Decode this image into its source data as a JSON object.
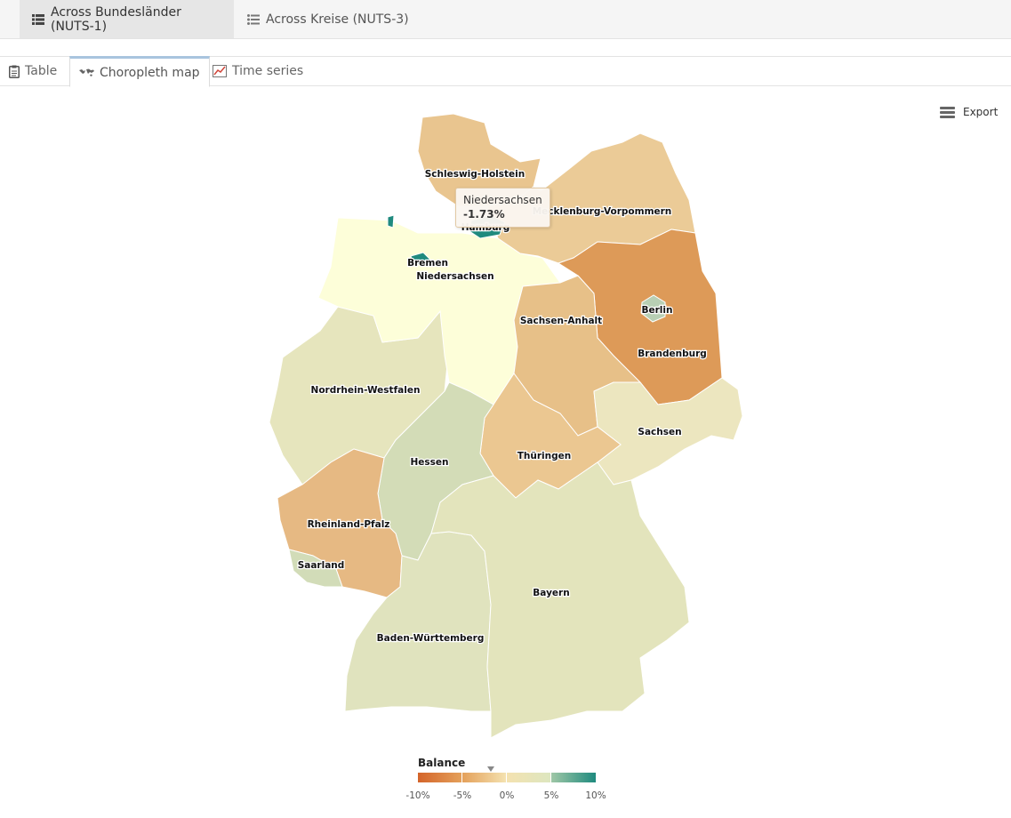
{
  "top_tabs": [
    {
      "label": "Across Bundesländer (NUTS-1)",
      "active": true
    },
    {
      "label": "Across Kreise (NUTS-3)",
      "active": false
    }
  ],
  "view_tabs": [
    {
      "label": "Table",
      "active": false
    },
    {
      "label": "Choropleth map",
      "active": true
    },
    {
      "label": "Time series",
      "active": false
    }
  ],
  "export_label": "Export",
  "tooltip": {
    "region": "Niedersachsen",
    "value": "-1.73%"
  },
  "legend": {
    "title": "Balance",
    "ticks": [
      "-10%",
      "-5%",
      "0%",
      "5%",
      "10%"
    ],
    "colors": [
      "#d4642a",
      "#e4a05a",
      "#f4e2b0",
      "#dde6bf",
      "#9fc7a6",
      "#1f8a7e"
    ]
  },
  "regions": {
    "schleswig_holstein": {
      "label": "Schleswig-Holstein",
      "color": "#e9c58f"
    },
    "hamburg": {
      "label": "Hamburg",
      "color": "#1f8a7e"
    },
    "mecklenburg_vorpommern": {
      "label": "Mecklenburg-Vorpommern",
      "color": "#ebcb97"
    },
    "bremen": {
      "label": "Bremen",
      "color": "#1f8a7e"
    },
    "niedersachsen": {
      "label": "Niedersachsen",
      "color": "#fdfed9"
    },
    "berlin": {
      "label": "Berlin",
      "color": "#b8cfb4"
    },
    "brandenburg": {
      "label": "Brandenburg",
      "color": "#dd9a58"
    },
    "sachsen_anhalt": {
      "label": "Sachsen-Anhalt",
      "color": "#e7c088"
    },
    "nordrhein_westfalen": {
      "label": "Nordrhein-Westfalen",
      "color": "#e6e5bd"
    },
    "sachsen": {
      "label": "Sachsen",
      "color": "#ece6bf"
    },
    "hessen": {
      "label": "Hessen",
      "color": "#d3dcb7"
    },
    "thueringen": {
      "label": "Thüringen",
      "color": "#ebc791"
    },
    "rheinland_pfalz": {
      "label": "Rheinland-Pfalz",
      "color": "#e6b983"
    },
    "saarland": {
      "label": "Saarland",
      "color": "#d2dcb8"
    },
    "bayern": {
      "label": "Bayern",
      "color": "#e3e4bc"
    },
    "baden_wuerttemberg": {
      "label": "Baden-Württemberg",
      "color": "#e0e3be"
    }
  }
}
